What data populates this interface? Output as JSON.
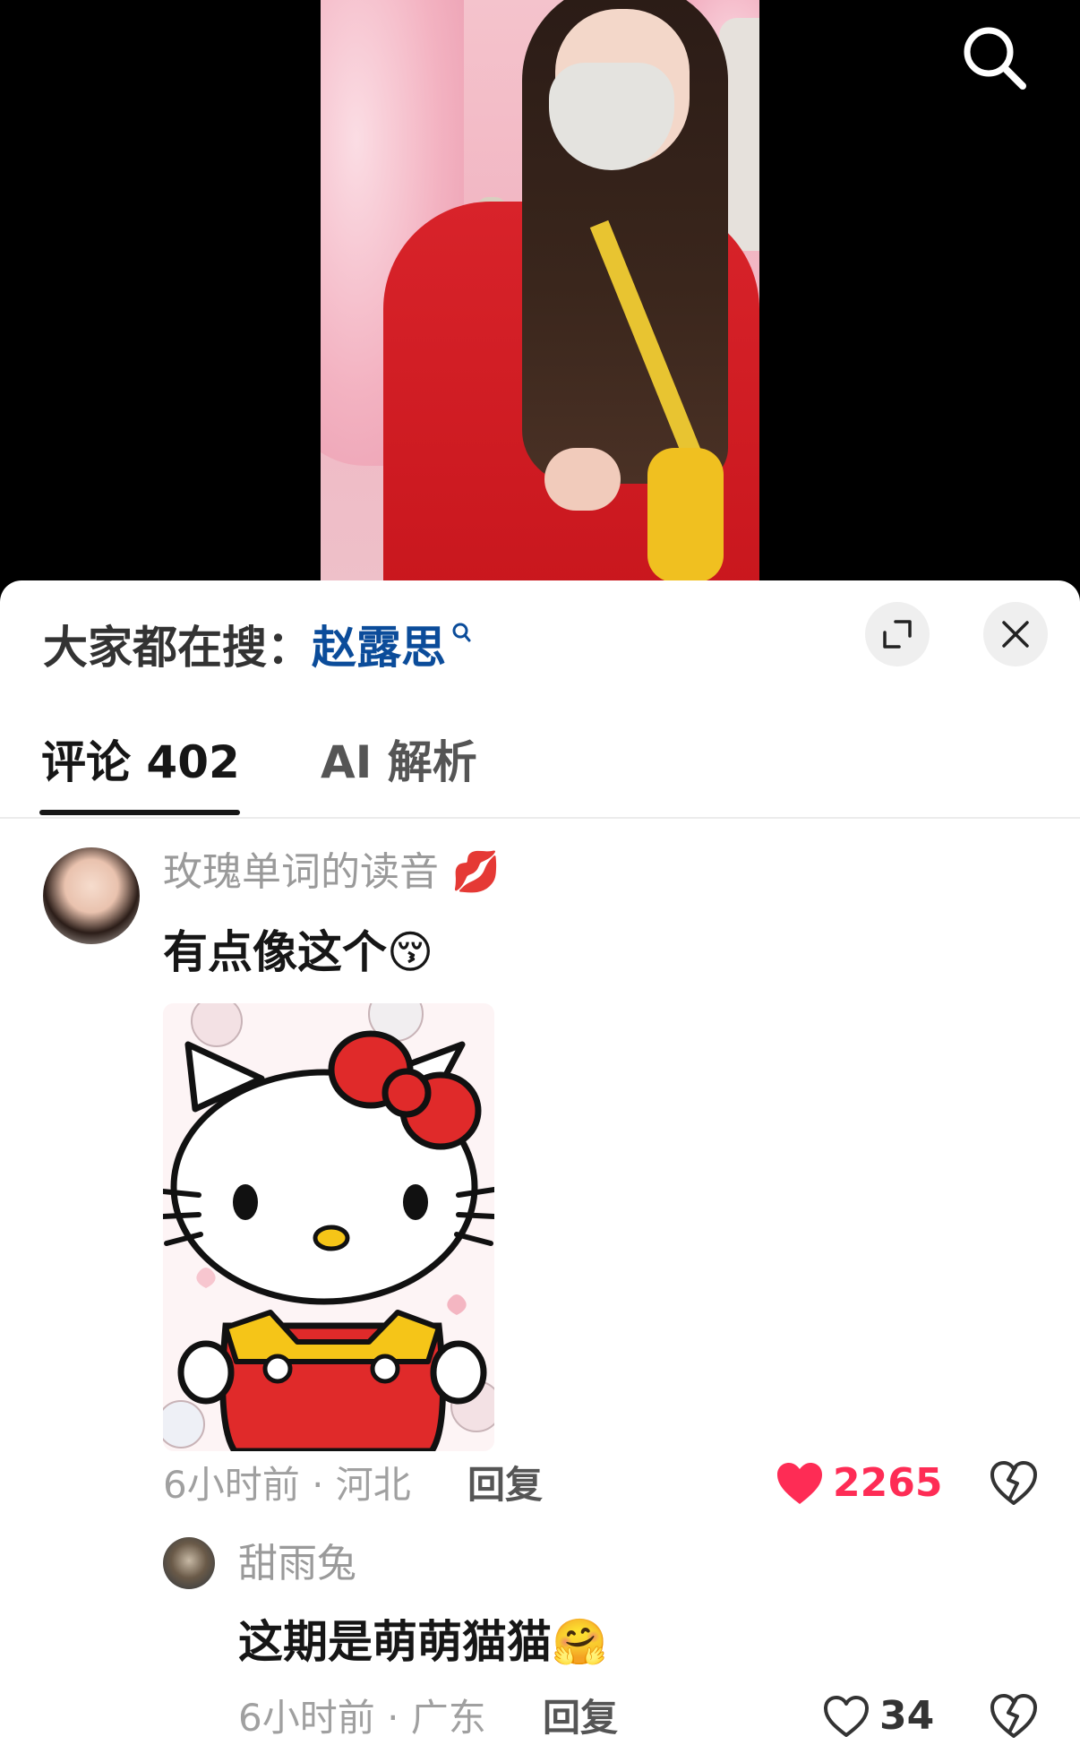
{
  "search_hint": {
    "prefix": "大家都在搜：",
    "keyword": "赵露思",
    "search_glyph": "ᵠ"
  },
  "tabs": [
    {
      "label": "评论 402",
      "active": true
    },
    {
      "label": "AI 解析",
      "active": false
    }
  ],
  "comments": [
    {
      "username": "玫瑰单词的读音",
      "username_emoji": "💋",
      "text": "有点像这个",
      "text_emoji": "😚",
      "has_image": true,
      "image_subject": "hello-kitty",
      "time_location": "6小时前 · 河北",
      "reply_label": "回复",
      "likes": "2265",
      "liked": true
    },
    {
      "username": "甜雨兔",
      "text": "这期是萌萌猫猫",
      "text_emoji": "🤗",
      "time_location": "6小时前 · 广东",
      "reply_label": "回复",
      "likes": "34",
      "liked": false
    }
  ],
  "colors": {
    "accent_like": "#fe2c55",
    "keyword_blue": "#0b4c9a",
    "text_primary": "#161616",
    "text_secondary": "#9a9a9a"
  },
  "icons": [
    "search-icon",
    "expand-icon",
    "close-icon",
    "heart-filled-icon",
    "heart-outline-icon",
    "dislike-icon"
  ]
}
